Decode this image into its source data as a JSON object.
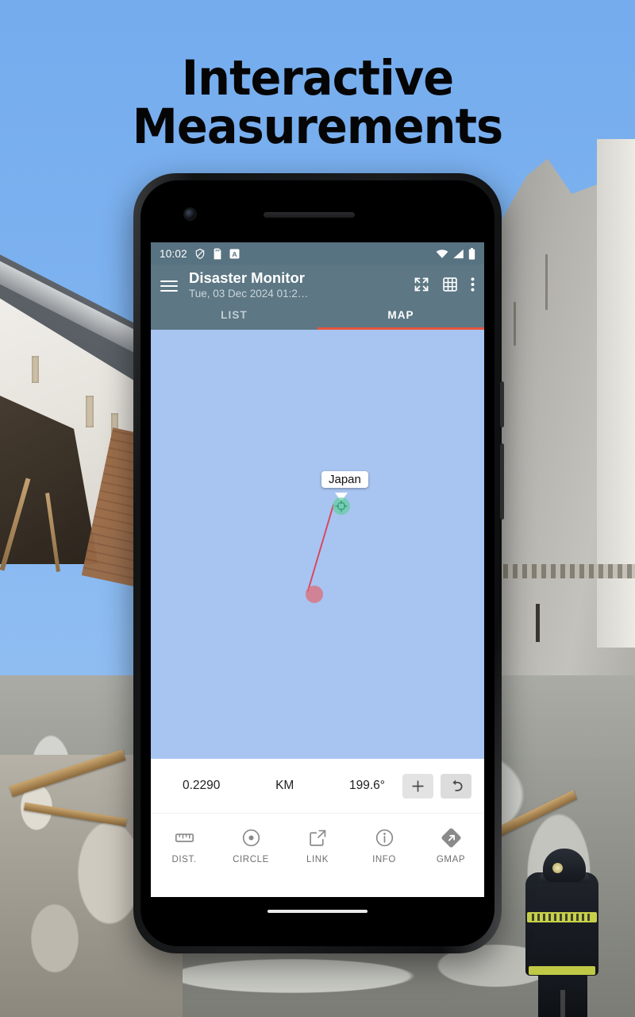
{
  "headline": "Interactive Measurements",
  "background": {
    "scene_description": "Earthquake-damaged buildings with rubble and a firefighter",
    "sky_color": "#7fb3ef"
  },
  "phone": {
    "status_bar": {
      "time": "10:02",
      "icons_left": [
        "shield-icon",
        "sd-card-icon",
        "letter-a-icon"
      ],
      "icons_right": [
        "wifi-icon",
        "cellular-signal-icon",
        "battery-icon"
      ]
    },
    "app_bar": {
      "menu_icon": "hamburger-menu-icon",
      "title": "Disaster Monitor",
      "subtitle": "Tue, 03 Dec 2024 01:2…",
      "actions": [
        "fullscreen-icon",
        "grid-icon",
        "overflow-menu-icon"
      ],
      "background_color": "#5d7784"
    },
    "tabs": {
      "items": [
        {
          "label": "LIST",
          "active": false
        },
        {
          "label": "MAP",
          "active": true
        }
      ],
      "indicator_color": "#e8543f"
    },
    "map": {
      "background_color": "#a8c4f0",
      "callout_label": "Japan",
      "markers": [
        {
          "name": "origin-marker",
          "type": "crosshair",
          "color": "#5acd96"
        },
        {
          "name": "endpoint-marker",
          "type": "dot",
          "color": "#e16973"
        }
      ],
      "line_color": "#d9455c"
    },
    "measurement": {
      "distance": "0.2290",
      "unit": "KM",
      "bearing": "199.6°",
      "add_button": "+",
      "undo_button": "undo-icon"
    },
    "bottom_nav": [
      {
        "label": "DIST.",
        "icon": "ruler-icon"
      },
      {
        "label": "CIRCLE",
        "icon": "circle-dot-icon"
      },
      {
        "label": "LINK",
        "icon": "external-link-icon"
      },
      {
        "label": "INFO",
        "icon": "info-icon"
      },
      {
        "label": "GMAP",
        "icon": "google-maps-icon"
      }
    ]
  }
}
